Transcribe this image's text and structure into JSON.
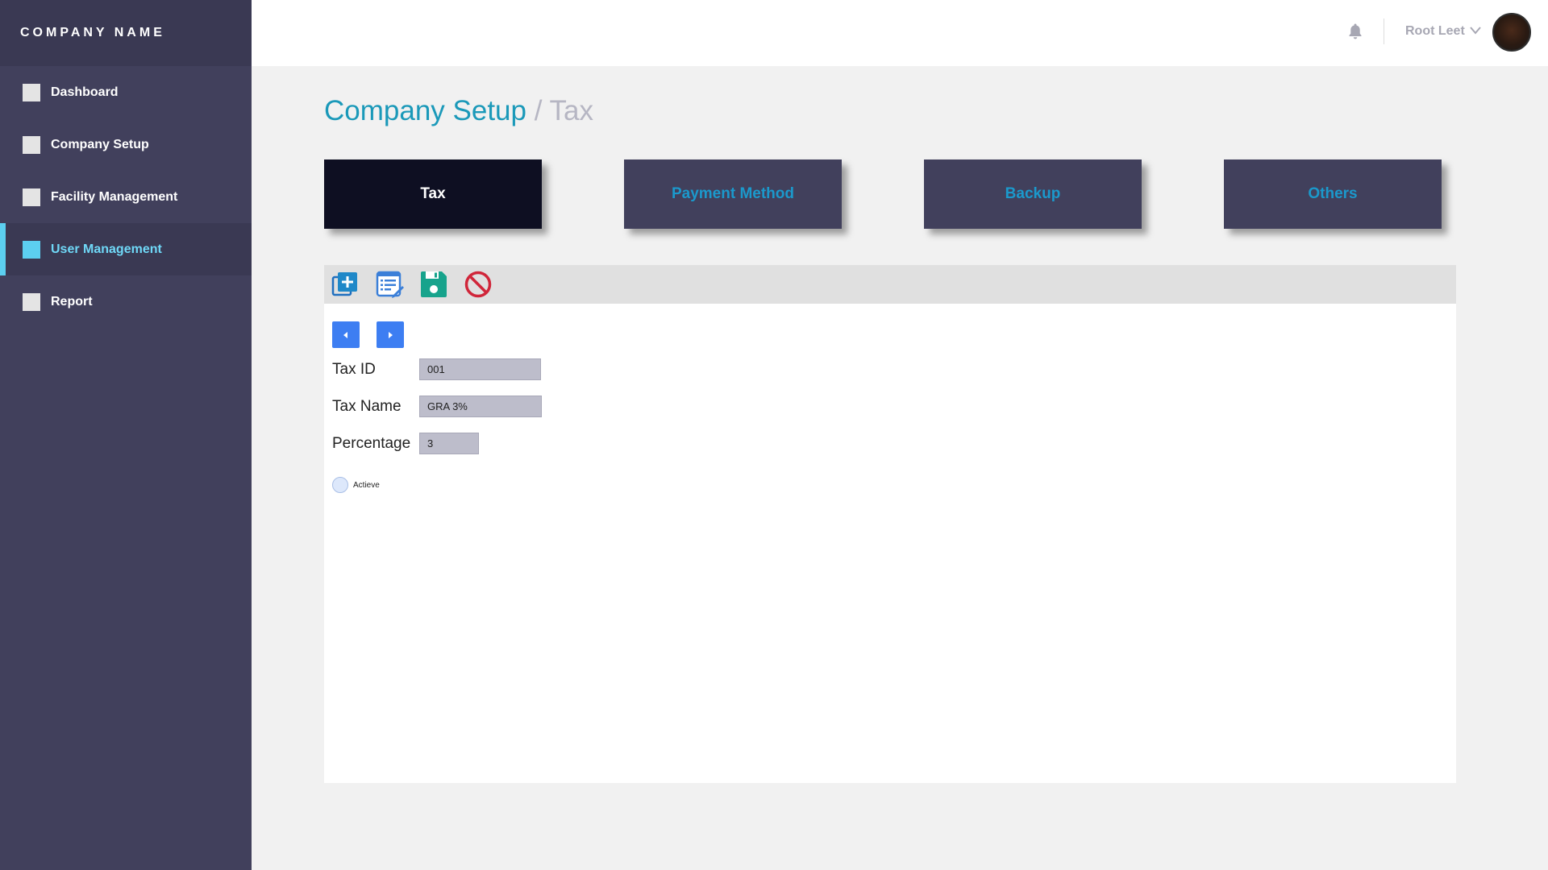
{
  "app": {
    "company_name": "COMPANY NAME"
  },
  "sidebar": {
    "items": [
      {
        "label": "Dashboard"
      },
      {
        "label": "Company Setup"
      },
      {
        "label": "Facility Management"
      },
      {
        "label": "User Management",
        "active": true
      },
      {
        "label": "Report"
      }
    ]
  },
  "topbar": {
    "icons": [
      "bell-icon",
      "chevron-down-icon"
    ],
    "username": "Root Leet"
  },
  "breadcrumb": {
    "main": "Company Setup",
    "separator": " / ",
    "sub": "Tax"
  },
  "tabs": [
    {
      "label": "Tax",
      "active": true
    },
    {
      "label": "Payment Method"
    },
    {
      "label": "Backup"
    },
    {
      "label": "Others"
    }
  ],
  "toolbar": {
    "icons": [
      "add-icon",
      "edit-list-icon",
      "save-icon",
      "cancel-icon"
    ]
  },
  "pager": {
    "icons": [
      "previous-icon",
      "next-icon"
    ]
  },
  "form": {
    "tax_id": {
      "label": "Tax ID",
      "value": "001"
    },
    "tax_name": {
      "label": "Tax Name",
      "value": "GRA 3%"
    },
    "percentage": {
      "label": "Percentage",
      "value": "3"
    },
    "active": {
      "label": "Actieve",
      "checked": false
    }
  },
  "colors": {
    "sidebar_bg": "#41405c",
    "accent": "#1b99b9",
    "active_nav": "#5ccff0",
    "active_tab": "#0e0f22",
    "pager_blue": "#3d7ef2"
  }
}
